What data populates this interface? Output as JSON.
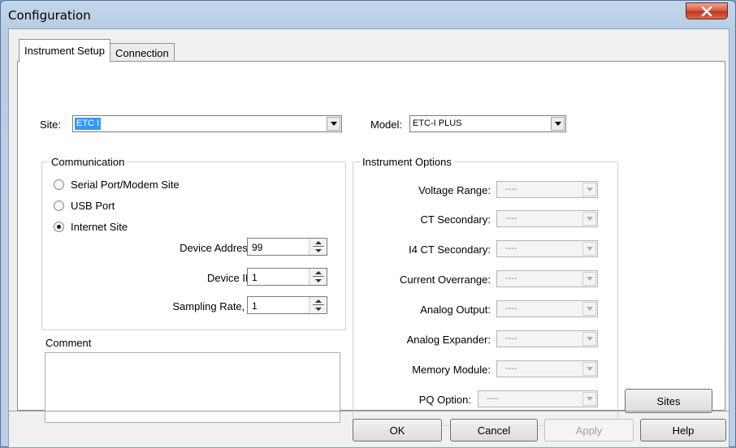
{
  "window": {
    "title": "Configuration"
  },
  "tabs": [
    {
      "label": "Instrument Setup",
      "active": true
    },
    {
      "label": "Connection",
      "active": false
    }
  ],
  "site": {
    "label": "Site:",
    "value": "ETC I"
  },
  "model": {
    "label": "Model:",
    "value": "ETC-I PLUS"
  },
  "communication": {
    "title": "Communication",
    "options": [
      {
        "label": "Serial Port/Modem Site",
        "selected": false
      },
      {
        "label": "USB Port",
        "selected": false
      },
      {
        "label": "Internet Site",
        "selected": true
      }
    ],
    "fields": [
      {
        "label": "Device Address:",
        "value": "99"
      },
      {
        "label": "Device ID:",
        "value": "1"
      },
      {
        "label": "Sampling Rate, s:",
        "value": "1"
      }
    ]
  },
  "comment": {
    "label": "Comment",
    "value": ""
  },
  "instrument_options": {
    "title": "Instrument Options",
    "items": [
      {
        "label": "Voltage Range:",
        "value": "----"
      },
      {
        "label": "CT Secondary:",
        "value": "----"
      },
      {
        "label": "I4 CT Secondary:",
        "value": "----"
      },
      {
        "label": "Current Overrange:",
        "value": "----"
      },
      {
        "label": "Analog Output:",
        "value": "----"
      },
      {
        "label": "Analog Expander:",
        "value": "----"
      },
      {
        "label": "Memory Module:",
        "value": "----"
      },
      {
        "label": "PQ Option:",
        "value": "----"
      }
    ]
  },
  "buttons": {
    "sites": "Sites",
    "ok": "OK",
    "cancel": "Cancel",
    "apply": "Apply",
    "help": "Help"
  },
  "colors": {
    "selection": "#3399ff",
    "close_button": "#c2371f"
  }
}
